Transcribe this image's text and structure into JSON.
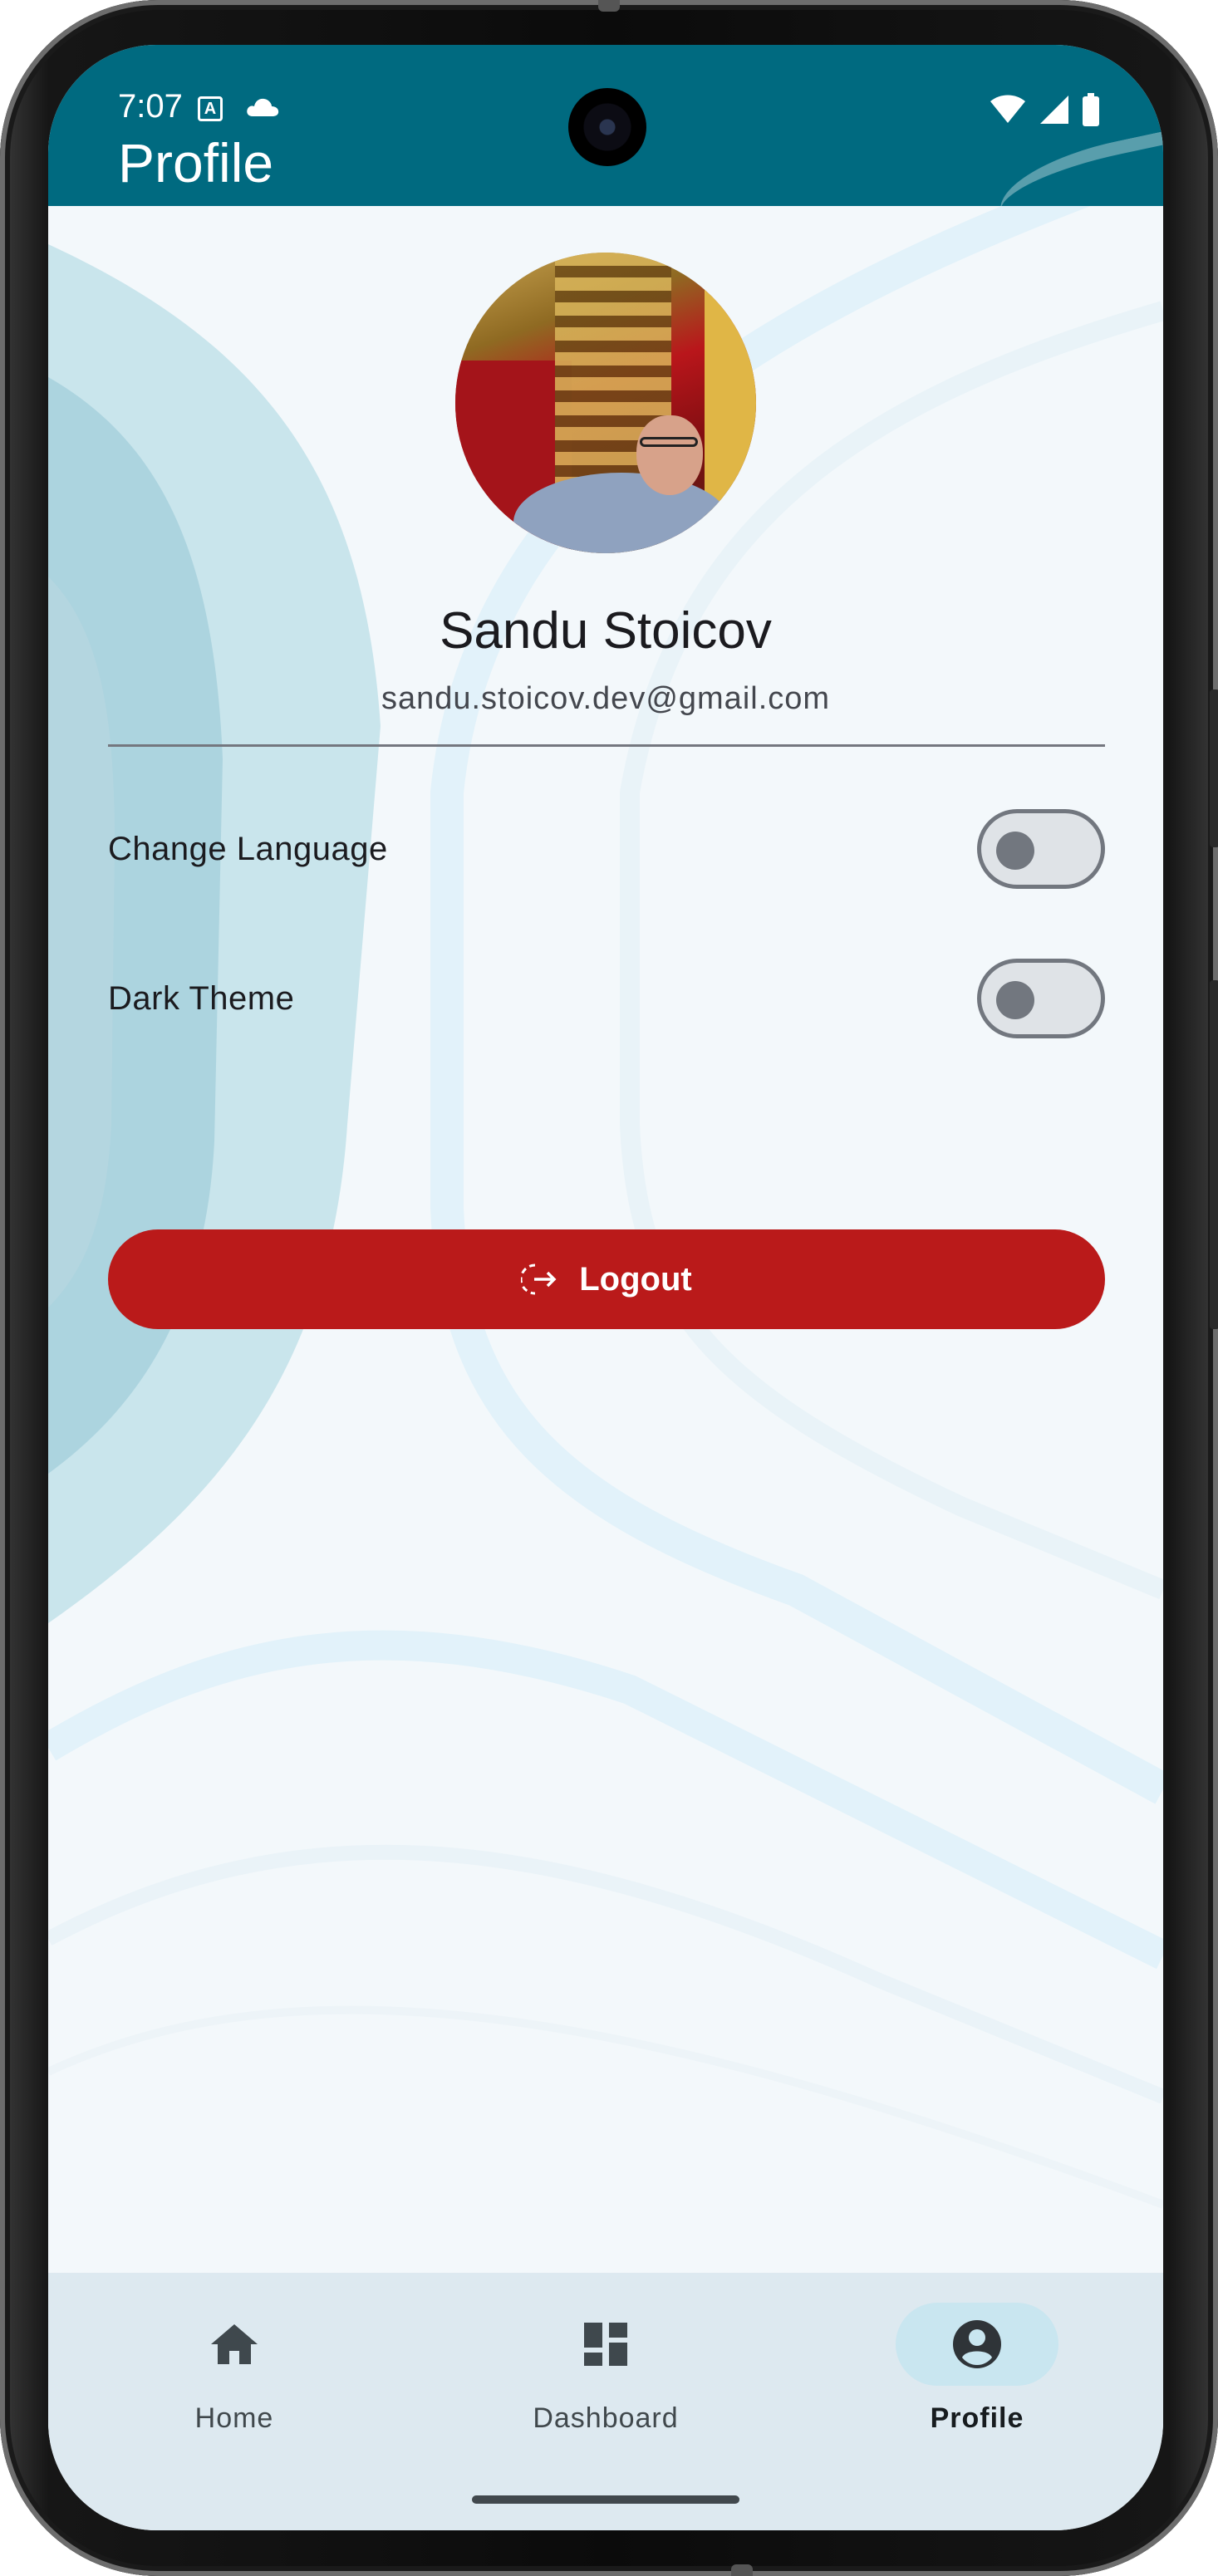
{
  "status_bar": {
    "time": "7:07",
    "left_icons": [
      "a-notification-icon",
      "cloud-icon"
    ],
    "right_icons": [
      "wifi-icon",
      "signal-icon",
      "battery-icon"
    ]
  },
  "header": {
    "title": "Profile",
    "background_color": "#006a80"
  },
  "profile": {
    "name": "Sandu Stoicov",
    "email": "sandu.stoicov.dev@gmail.com",
    "avatar": "profile-photo"
  },
  "settings": [
    {
      "label": "Change Language",
      "enabled": false
    },
    {
      "label": "Dark Theme",
      "enabled": false
    }
  ],
  "logout": {
    "label": "Logout",
    "icon": "logout-icon",
    "color": "#ba1a1a"
  },
  "bottom_nav": {
    "items": [
      {
        "label": "Home",
        "icon": "home-icon",
        "active": false
      },
      {
        "label": "Dashboard",
        "icon": "dashboard-icon",
        "active": false
      },
      {
        "label": "Profile",
        "icon": "account-circle-icon",
        "active": true
      }
    ]
  }
}
